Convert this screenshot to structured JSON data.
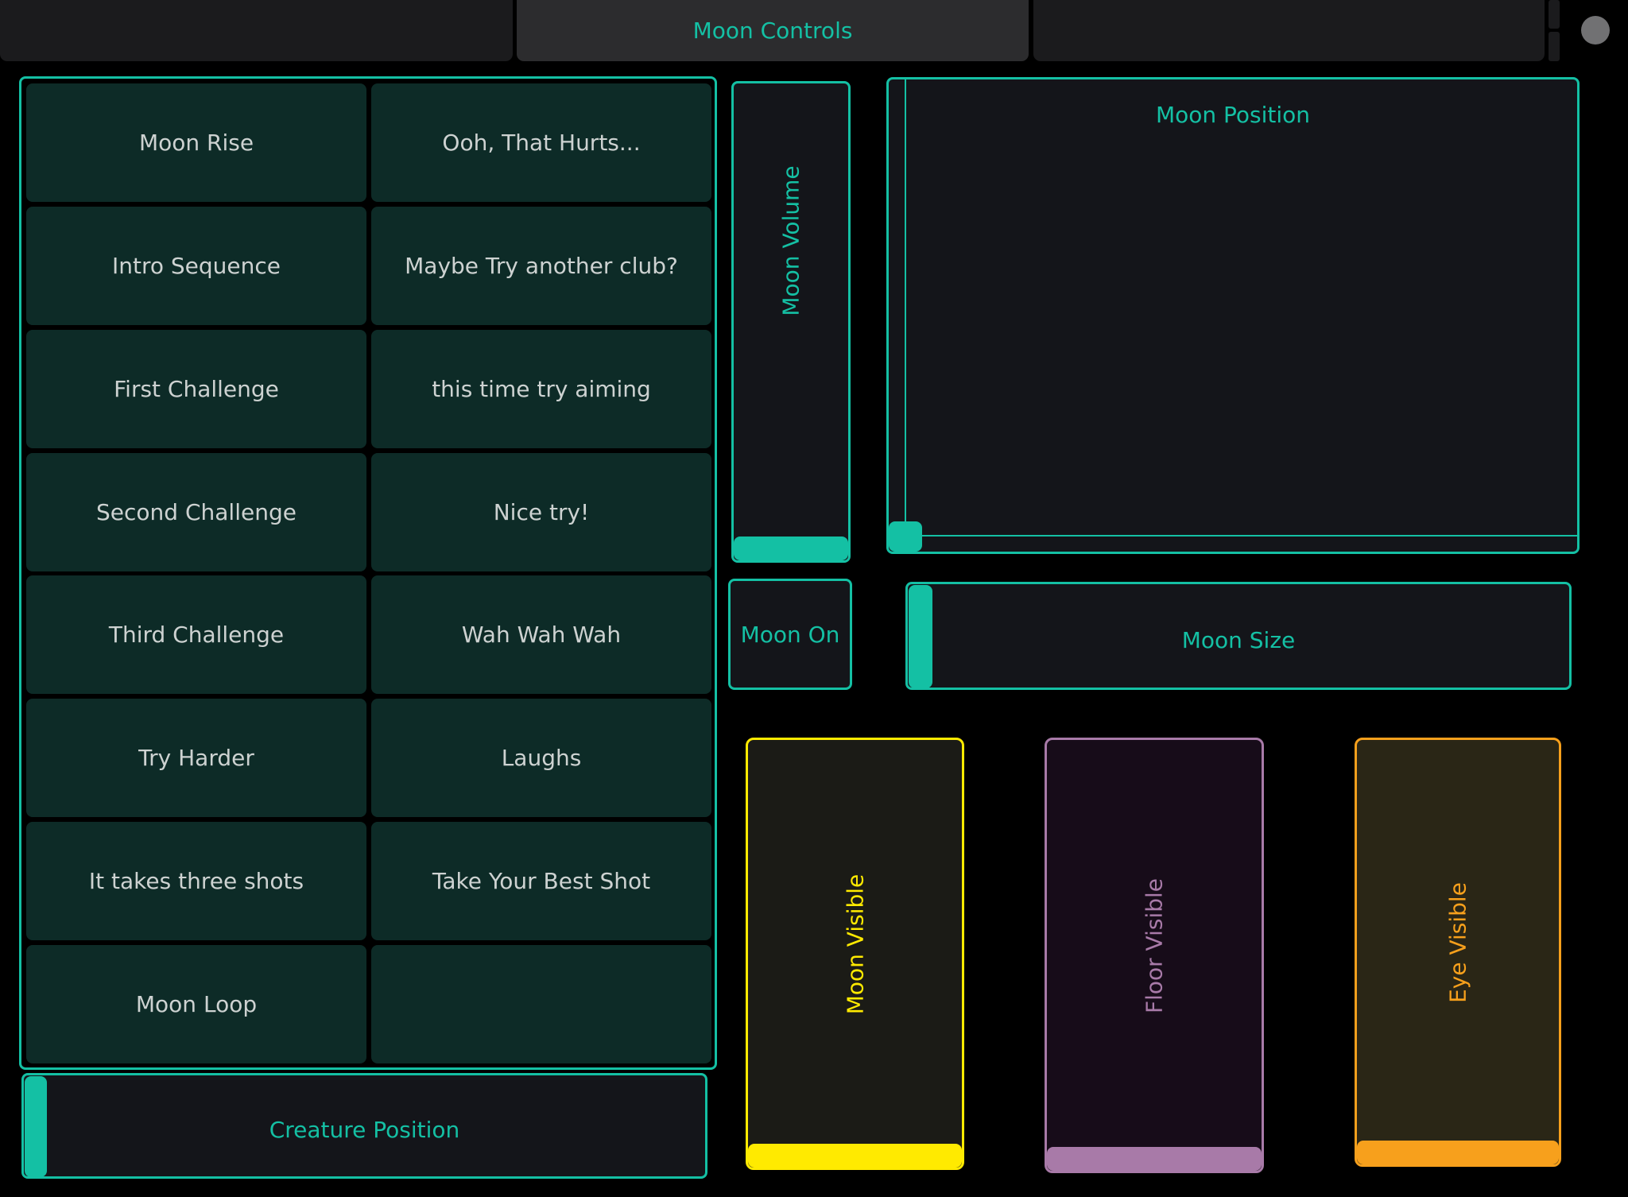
{
  "tabs": [
    {
      "label": ""
    },
    {
      "label": "Moon Controls"
    },
    {
      "label": ""
    }
  ],
  "grid": {
    "buttons": [
      {
        "label": "Moon Rise"
      },
      {
        "label": "Ooh, That Hurts..."
      },
      {
        "label": "Intro Sequence"
      },
      {
        "label": "Maybe Try another club?"
      },
      {
        "label": "First Challenge"
      },
      {
        "label": "this time try aiming"
      },
      {
        "label": "Second Challenge"
      },
      {
        "label": "Nice try!"
      },
      {
        "label": "Third Challenge"
      },
      {
        "label": "Wah Wah Wah"
      },
      {
        "label": "Try Harder"
      },
      {
        "label": "Laughs"
      },
      {
        "label": "It takes three shots"
      },
      {
        "label": "Take Your Best Shot"
      },
      {
        "label": "Moon Loop"
      },
      {
        "label": ""
      }
    ]
  },
  "creature_position": {
    "label": "Creature Position",
    "value": 0
  },
  "moon_volume": {
    "label": "Moon Volume",
    "value": 0
  },
  "moon_on": {
    "label": "Moon On"
  },
  "moon_position": {
    "label": "Moon Position",
    "x": 0,
    "y": 0
  },
  "moon_size": {
    "label": "Moon Size",
    "value": 0
  },
  "faders": [
    {
      "label": "Moon Visible",
      "color": "#ffea00",
      "bg": "#1b1b16",
      "value": 0
    },
    {
      "label": "Floor Visible",
      "color": "#a87aa8",
      "bg": "#170c19",
      "value": 0
    },
    {
      "label": "Eye Visible",
      "color": "#f7a01c",
      "bg": "#2a2616",
      "value": 0
    }
  ],
  "colors": {
    "accent": "#14c0a4",
    "background": "#000000",
    "button": "#0d2b27",
    "panel": "#14151a"
  }
}
